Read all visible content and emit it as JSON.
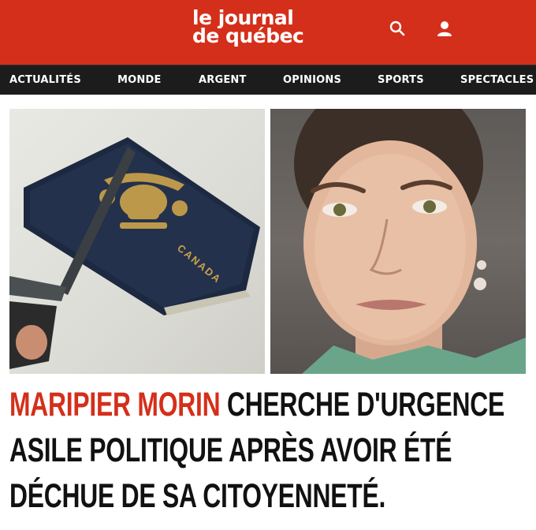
{
  "header": {
    "logo_line1": "le journal",
    "logo_line2": "de québec",
    "brand_color": "#d42f1a",
    "icons": [
      "search-icon",
      "user-icon"
    ]
  },
  "nav": {
    "items": [
      "ACTUALITÉS",
      "MONDE",
      "ARGENT",
      "OPINIONS",
      "SPORTS",
      "SPECTACLES"
    ]
  },
  "article": {
    "passport_text": "CANADA",
    "headline_highlight": "MARIPIER MORIN",
    "headline_rest": " CHERCHE D'URGENCE ASILE POLITIQUE APRÈS AVOIR ÉTÉ DÉCHUE DE SA CITOYENNETÉ."
  }
}
